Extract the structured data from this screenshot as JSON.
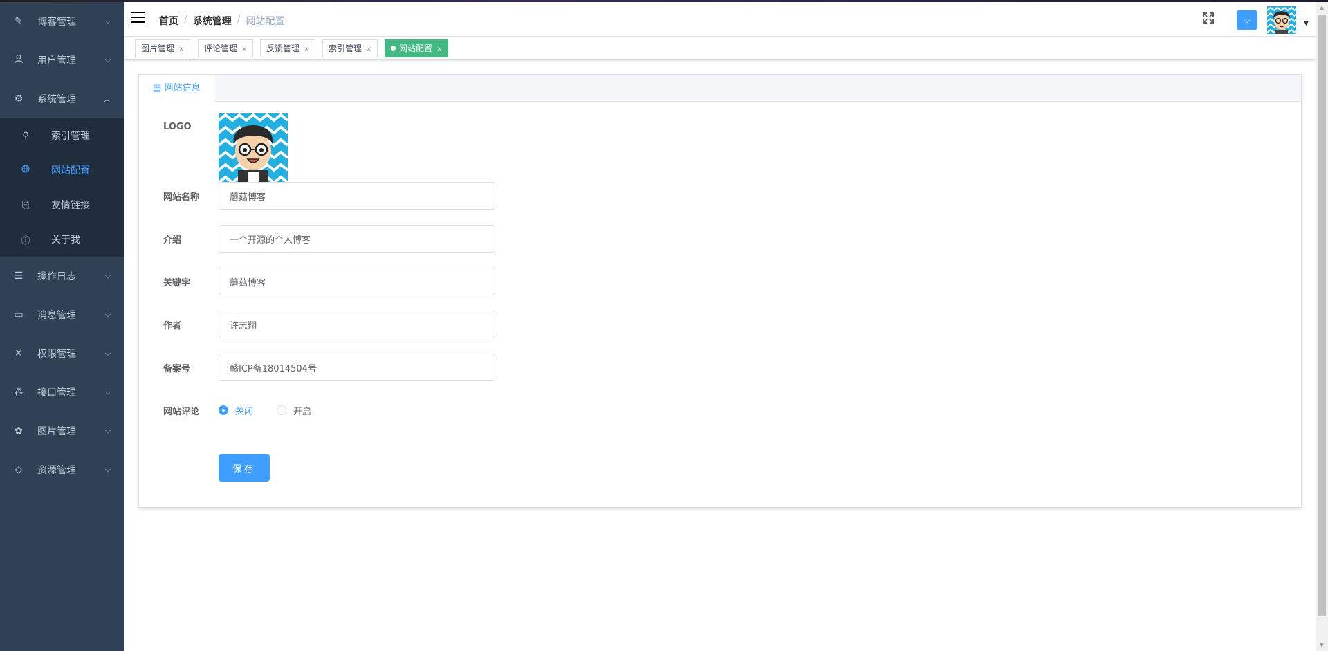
{
  "sidebar": {
    "items": [
      {
        "label": "博客管理",
        "icon": "edit-icon"
      },
      {
        "label": "用户管理",
        "icon": "user-icon"
      },
      {
        "label": "系统管理",
        "icon": "gear-icon"
      },
      {
        "label": "操作日志",
        "icon": "log-icon"
      },
      {
        "label": "消息管理",
        "icon": "message-icon"
      },
      {
        "label": "权限管理",
        "icon": "tools-icon"
      },
      {
        "label": "接口管理",
        "icon": "tree-icon"
      },
      {
        "label": "图片管理",
        "icon": "image-icon"
      },
      {
        "label": "资源管理",
        "icon": "graduation-icon"
      }
    ],
    "submenu": [
      {
        "label": "索引管理",
        "icon": "search-index-icon"
      },
      {
        "label": "网站配置",
        "icon": "globe-icon"
      },
      {
        "label": "友情链接",
        "icon": "paperclip-icon"
      },
      {
        "label": "关于我",
        "icon": "info-icon"
      }
    ]
  },
  "breadcrumb": [
    "首页",
    "系统管理",
    "网站配置"
  ],
  "tags": [
    {
      "label": "图片管理"
    },
    {
      "label": "评论管理"
    },
    {
      "label": "反馈管理"
    },
    {
      "label": "索引管理"
    },
    {
      "label": "网站配置"
    }
  ],
  "tab": {
    "label": "网站信息"
  },
  "form": {
    "logo_label": "LOGO",
    "name_label": "网站名称",
    "name_value": "蘑菇博客",
    "summary_label": "介绍",
    "summary_value": "一个开源的个人博客",
    "keyword_label": "关键字",
    "keyword_value": "蘑菇博客",
    "author_label": "作者",
    "author_value": "许志翔",
    "record_label": "备案号",
    "record_value": "赣ICP备18014504号",
    "comment_label": "网站评论",
    "comment_options": [
      "关闭",
      "开启"
    ],
    "comment_selected": "关闭",
    "save_label": "保存"
  },
  "colors": {
    "sidebar_bg": "#304156",
    "submenu_bg": "#1f2d3d",
    "accent": "#409eff",
    "active_tag": "#42b983"
  }
}
